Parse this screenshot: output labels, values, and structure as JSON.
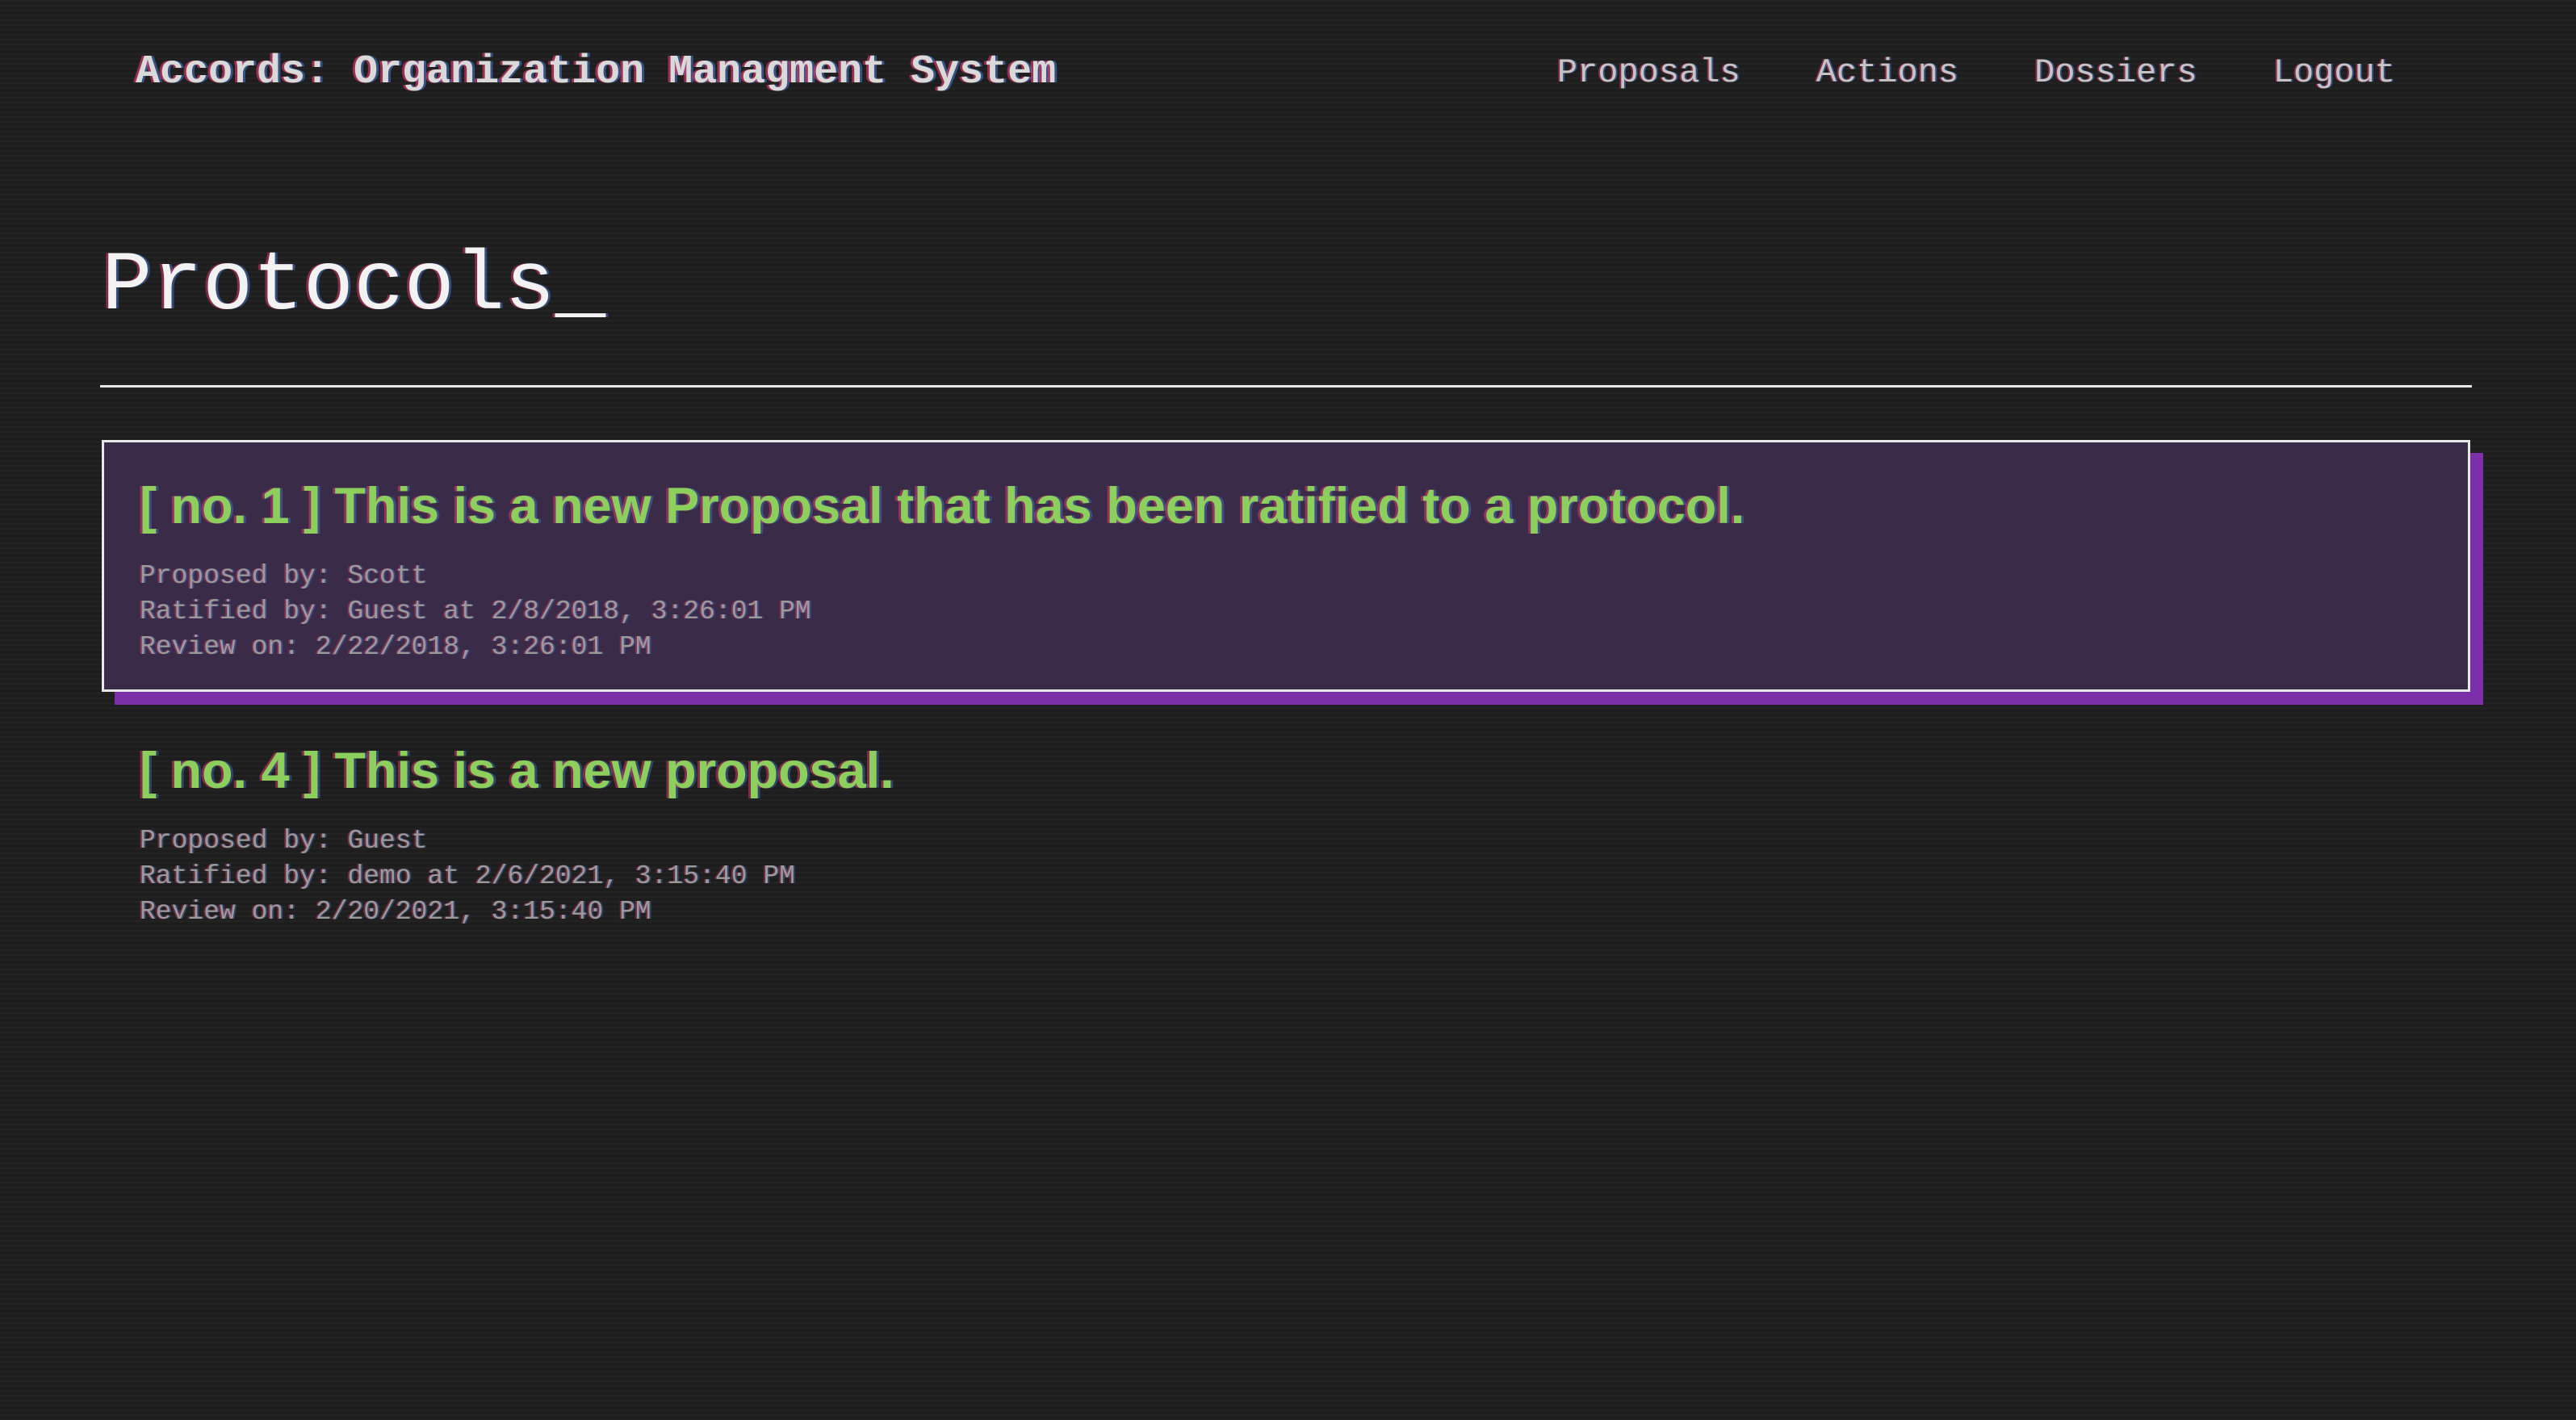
{
  "header": {
    "app_title": "Accords: Organization Managment System",
    "nav": [
      {
        "label": "Proposals"
      },
      {
        "label": "Actions"
      },
      {
        "label": "Dossiers"
      },
      {
        "label": "Logout"
      }
    ]
  },
  "page": {
    "title": "Protocols",
    "cursor": "_"
  },
  "protocols": [
    {
      "heading": "[ no. 1 ] This is a new Proposal that has been ratified to a protocol.",
      "proposed_by": "Proposed by: Scott",
      "ratified_by": "Ratified by: Guest at 2/8/2018, 3:26:01 PM",
      "review_on": "Review on: 2/22/2018, 3:26:01 PM",
      "selected": true
    },
    {
      "heading": "[ no. 4 ] This is a new proposal.",
      "proposed_by": "Proposed by: Guest",
      "ratified_by": "Ratified by: demo at 2/6/2021, 3:15:40 PM",
      "review_on": "Review on: 2/20/2021, 3:15:40 PM",
      "selected": false
    }
  ],
  "colors": {
    "background": "#1e1e1e",
    "heading_green": "#8ccf5c",
    "selected_card_bg": "#3a2c48",
    "selected_card_shadow": "#7b2fa8",
    "meta_text": "#9a9a9a"
  }
}
